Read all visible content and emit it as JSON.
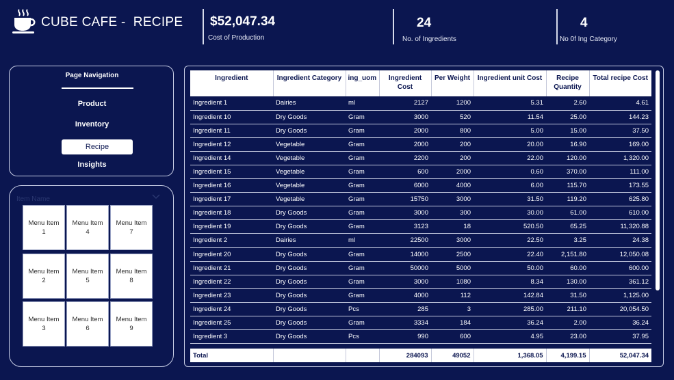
{
  "header": {
    "title": "CUBE CAFE -  RECIPE",
    "logo_icon": "coffee-cup-icon"
  },
  "kpis": [
    {
      "value": "$52,047.34",
      "label": "Cost of Production"
    },
    {
      "value": "24",
      "label": "No. of Ingredients"
    },
    {
      "value": "4",
      "label": "No 0f Ing Category"
    }
  ],
  "navigation": {
    "title": "Page Navigation",
    "items": [
      "Product",
      "Inventory",
      "Recipe",
      "Insights"
    ],
    "selected": "Recipe"
  },
  "slicer": {
    "header": "Item Name",
    "chevron_icon": "chevron-down-icon",
    "tiles": [
      [
        "Menu Item",
        "1"
      ],
      [
        "Menu Item",
        "4"
      ],
      [
        "Menu Item",
        "7"
      ],
      [
        "Menu Item",
        "2"
      ],
      [
        "Menu Item",
        "5"
      ],
      [
        "Menu Item",
        "8"
      ],
      [
        "Menu Item",
        "3"
      ],
      [
        "Menu Item",
        "6"
      ],
      [
        "Menu Item",
        "9"
      ]
    ]
  },
  "table": {
    "columns": [
      "Ingredient",
      "Ingredient Category",
      "ing_uom",
      "Ingredient Cost",
      "Per Weight",
      "Ingredient unit Cost",
      "Recipe Quantity",
      "Total recipe Cost"
    ],
    "rows": [
      [
        "Ingredient 1",
        "Dairies",
        "ml",
        "2127",
        "1200",
        "5.31",
        "2.60",
        "4.61"
      ],
      [
        "Ingredient 10",
        "Dry Goods",
        "Gram",
        "3000",
        "520",
        "11.54",
        "25.00",
        "144.23"
      ],
      [
        "Ingredient 11",
        "Dry Goods",
        "Gram",
        "2000",
        "800",
        "5.00",
        "15.00",
        "37.50"
      ],
      [
        "Ingredient 12",
        "Vegetable",
        "Gram",
        "2000",
        "200",
        "20.00",
        "16.90",
        "169.00"
      ],
      [
        "Ingredient 14",
        "Vegetable",
        "Gram",
        "2200",
        "200",
        "22.00",
        "120.00",
        "1,320.00"
      ],
      [
        "Ingredient 15",
        "Vegetable",
        "Gram",
        "600",
        "2000",
        "0.60",
        "370.00",
        "111.00"
      ],
      [
        "Ingredient 16",
        "Vegetable",
        "Gram",
        "6000",
        "4000",
        "6.00",
        "115.70",
        "173.55"
      ],
      [
        "Ingredient 17",
        "Vegetable",
        "Gram",
        "15750",
        "3000",
        "31.50",
        "119.20",
        "625.80"
      ],
      [
        "Ingredient 18",
        "Dry Goods",
        "Gram",
        "3000",
        "300",
        "30.00",
        "61.00",
        "610.00"
      ],
      [
        "Ingredient 19",
        "Dry Goods",
        "Gram",
        "3123",
        "18",
        "520.50",
        "65.25",
        "11,320.88"
      ],
      [
        "Ingredient 2",
        "Dairies",
        "ml",
        "22500",
        "3000",
        "22.50",
        "3.25",
        "24.38"
      ],
      [
        "Ingredient 20",
        "Dry Goods",
        "Gram",
        "14000",
        "2500",
        "22.40",
        "2,151.80",
        "12,050.08"
      ],
      [
        "Ingredient 21",
        "Dry Goods",
        "Gram",
        "50000",
        "5000",
        "50.00",
        "60.00",
        "600.00"
      ],
      [
        "Ingredient 22",
        "Dry Goods",
        "Gram",
        "3000",
        "1080",
        "8.34",
        "130.00",
        "361.12"
      ],
      [
        "Ingredient 23",
        "Dry Goods",
        "Gram",
        "4000",
        "112",
        "142.84",
        "31.50",
        "1,125.00"
      ],
      [
        "Ingredient 24",
        "Dry Goods",
        "Pcs",
        "285",
        "3",
        "285.00",
        "211.10",
        "20,054.50"
      ],
      [
        "Ingredient 25",
        "Dry Goods",
        "Gram",
        "3334",
        "184",
        "36.24",
        "2.00",
        "36.24"
      ],
      [
        "Ingredient 3",
        "Dry Goods",
        "Pcs",
        "990",
        "600",
        "4.95",
        "23.00",
        "37.95"
      ]
    ],
    "total": [
      "Total",
      "",
      "",
      "284093",
      "49052",
      "1,368.05",
      "4,199.15",
      "52,047.34"
    ]
  },
  "colors": {
    "background": "#0b1650",
    "card_border": "#c9cfe6",
    "header_bg": "#ffffff"
  }
}
